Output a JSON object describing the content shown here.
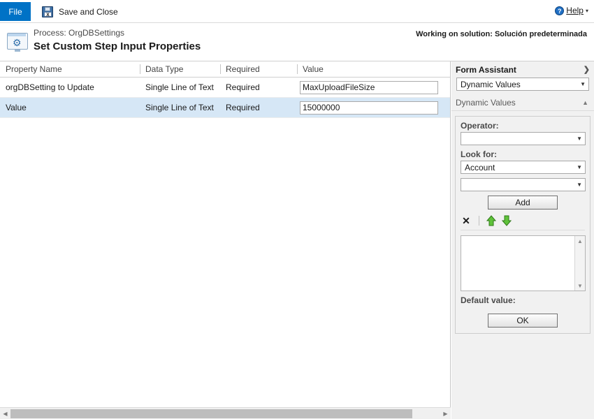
{
  "ribbon": {
    "file_tab": "File",
    "save_and_close": "Save and Close",
    "save_icon": "save-floppy-icon",
    "help_label": "Help",
    "help_icon": "help-question-icon",
    "help_caret": "▾"
  },
  "header": {
    "process_label": "Process: OrgDBSettings",
    "title": "Set Custom Step Input Properties",
    "icon": "process-gear-icon",
    "solution_note": "Working on solution: Solución predeterminada"
  },
  "grid": {
    "columns": [
      "Property Name",
      "Data Type",
      "Required",
      "Value"
    ],
    "rows": [
      {
        "property_name": "orgDBSetting to Update",
        "data_type": "Single Line of Text",
        "required": "Required",
        "value": "MaxUploadFileSize",
        "selected": false
      },
      {
        "property_name": "Value",
        "data_type": "Single Line of Text",
        "required": "Required",
        "value": "15000000",
        "selected": true
      }
    ],
    "scroll_left_icon": "◀",
    "scroll_right_icon": "▶"
  },
  "form_assistant": {
    "title": "Form Assistant",
    "collapse_icon": "❯",
    "mode_select": {
      "value": "Dynamic Values",
      "arrow": "▼"
    },
    "section": {
      "title": "Dynamic Values",
      "collapse_icon": "▲"
    },
    "operator_label": "Operator:",
    "operator_value": "",
    "look_for_label": "Look for:",
    "look_for_value": "Account",
    "look_for_second_value": "",
    "dropdown_arrow": "▼",
    "add_button": "Add",
    "toolbar": {
      "delete_icon": "✕",
      "move_up_icon": "arrow-up-green-icon",
      "move_down_icon": "arrow-down-green-icon"
    },
    "list_items": [],
    "list_scroll_up": "▲",
    "list_scroll_down": "▼",
    "default_value_label": "Default value:",
    "ok_button": "OK"
  },
  "colors": {
    "file_tab_blue": "#0072c6",
    "selected_row_blue": "#d6e7f6",
    "panel_grey": "#f1f1f1",
    "green_arrow": "#55b832"
  }
}
